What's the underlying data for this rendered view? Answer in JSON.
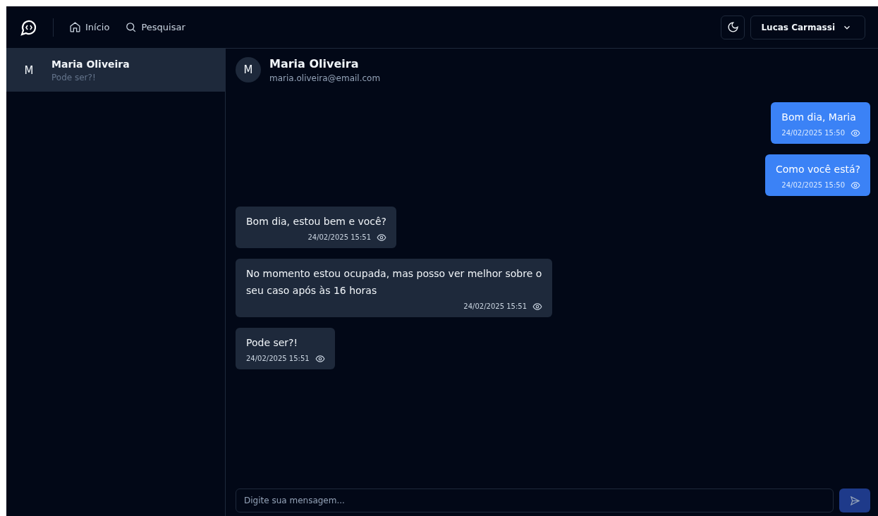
{
  "topbar": {
    "nav": [
      {
        "kind": "home",
        "label": "Início"
      },
      {
        "kind": "search",
        "label": "Pesquisar"
      }
    ],
    "user": "Lucas Carmassi"
  },
  "conversations": [
    {
      "avatar": "M",
      "name": "Maria Oliveira",
      "preview": "Pode ser?!",
      "selected": true
    }
  ],
  "chat": {
    "avatar": "M",
    "name": "Maria Oliveira",
    "email": "maria.oliveira@email.com",
    "messages": [
      {
        "kind": "sent",
        "text": "Bom dia, Maria",
        "time": "24/02/2025 15:50"
      },
      {
        "kind": "sent",
        "text": "Como você está?",
        "time": "24/02/2025 15:50"
      },
      {
        "kind": "received",
        "text": "Bom dia, estou bem e você?",
        "time": "24/02/2025 15:51"
      },
      {
        "kind": "received",
        "text": "No momento estou ocupada, mas posso ver melhor sobre o seu caso após às 16 horas",
        "time": "24/02/2025 15:51"
      },
      {
        "kind": "received",
        "text": "Pode ser?!",
        "time": "24/02/2025 15:51"
      }
    ],
    "composer": {
      "placeholder": "Digite sua mensagem..."
    }
  }
}
